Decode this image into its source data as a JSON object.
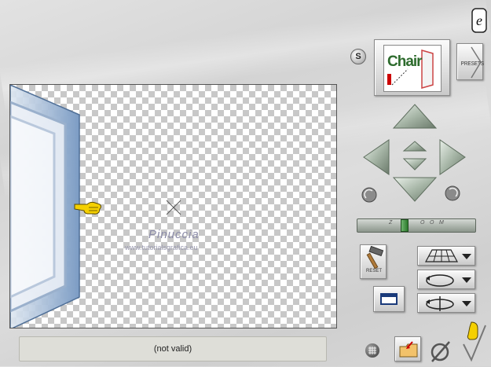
{
  "presets": {
    "label": "PRESETS"
  },
  "preview": {
    "text": "Chair"
  },
  "zoom_ticks": [
    "Z",
    "O",
    "O",
    "M"
  ],
  "reset": {
    "label": "RESET"
  },
  "watermark": {
    "name": "Pinuccia",
    "url": "www.tutorialsgrafica.eu"
  },
  "status": {
    "text": "(not valid)"
  },
  "s_button": {
    "label": "S"
  },
  "colors": {
    "frame": "#7c9cc4",
    "arrow": "#a9b8a9",
    "hand": "#f5d000"
  }
}
